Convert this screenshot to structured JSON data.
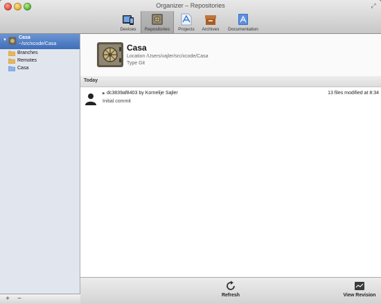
{
  "window": {
    "title": "Organizer – Repositories"
  },
  "toolbar": {
    "items": [
      {
        "label": "Devices"
      },
      {
        "label": "Repositories"
      },
      {
        "label": "Projects"
      },
      {
        "label": "Archives"
      },
      {
        "label": "Documentation"
      }
    ]
  },
  "sidebar": {
    "repo": {
      "name": "Casa",
      "path": "~/src/xcode/Casa"
    },
    "items": [
      {
        "label": "Branches",
        "icon": "folder-icon"
      },
      {
        "label": "Remotes",
        "icon": "folder-icon"
      },
      {
        "label": "Casa",
        "icon": "folder-blue-icon"
      }
    ],
    "footer": {
      "add": "+",
      "remove": "−"
    }
  },
  "repo_header": {
    "name": "Casa",
    "location_label": "Location",
    "location_value": "/Users/vajler/src/xcode/Casa",
    "type_label": "Type",
    "type_value": "Git"
  },
  "history": {
    "section": "Today",
    "commits": [
      {
        "hash_author": "dc3839af8403 by Kornelije Sajler",
        "message": "Initial commit",
        "summary": "13 files modified at 8:34"
      }
    ]
  },
  "footer_actions": {
    "refresh": "Refresh",
    "view_revision": "View Revision"
  },
  "colors": {
    "selection": "#4f7fc6",
    "sidebar_bg": "#e1e6ee"
  }
}
